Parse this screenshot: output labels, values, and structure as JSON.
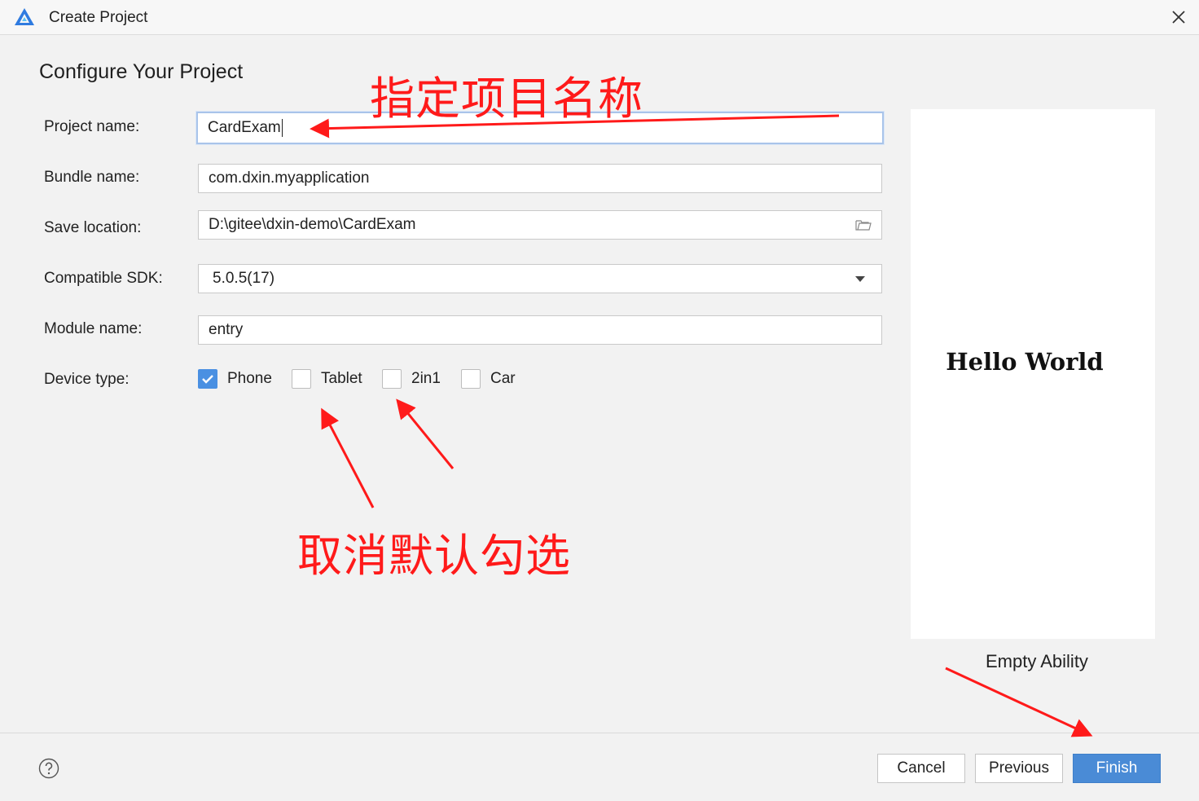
{
  "window": {
    "title": "Create Project",
    "logo_icon": "app-logo-icon",
    "close_icon": "close-icon"
  },
  "page": {
    "heading": "Configure Your Project"
  },
  "form": {
    "project_name": {
      "label": "Project name:",
      "value": "CardExam"
    },
    "bundle_name": {
      "label": "Bundle name:",
      "value": "com.dxin.myapplication"
    },
    "save_location": {
      "label": "Save location:",
      "value": "D:\\gitee\\dxin-demo\\CardExam",
      "icon": "folder-icon"
    },
    "compatible_sdk": {
      "label": "Compatible SDK:",
      "value": "5.0.5(17)",
      "icon": "chevron-down-icon"
    },
    "module_name": {
      "label": "Module name:",
      "value": "entry"
    },
    "device_type": {
      "label": "Device type:",
      "options": [
        {
          "label": "Phone",
          "checked": true
        },
        {
          "label": "Tablet",
          "checked": false
        },
        {
          "label": "2in1",
          "checked": false
        },
        {
          "label": "Car",
          "checked": false
        }
      ]
    }
  },
  "preview": {
    "text": "Hello World",
    "template": "Empty Ability"
  },
  "footer": {
    "help_icon": "help-icon",
    "cancel": "Cancel",
    "previous": "Previous",
    "finish": "Finish"
  },
  "annotations": {
    "top": "指定项目名称",
    "bottom": "取消默认勾选",
    "color": "#ff1a1a"
  },
  "colors": {
    "accent": "#4a8bd6",
    "checkbox": "#4a90e2",
    "focus_border": "#a9c4ea"
  }
}
